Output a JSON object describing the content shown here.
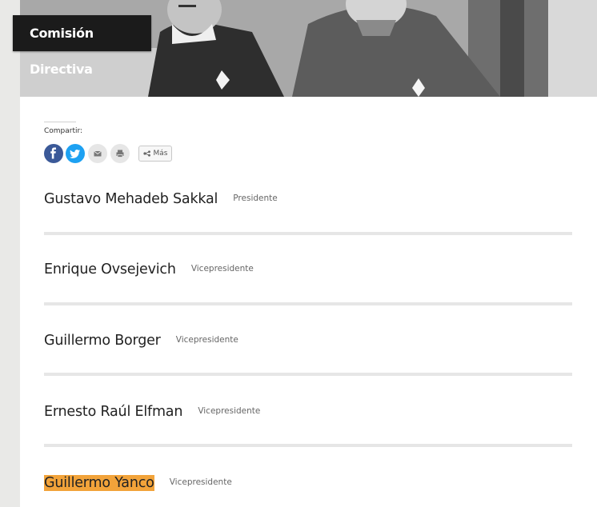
{
  "page": {
    "title": "Comisión Directiva"
  },
  "share": {
    "label": "Compartir:",
    "buttons": [
      {
        "icon": "facebook-icon",
        "color": "#3b5998"
      },
      {
        "icon": "twitter-icon",
        "color": "#1da1f2"
      },
      {
        "icon": "email-icon",
        "color": "#e6e6e6"
      },
      {
        "icon": "print-icon",
        "color": "#e6e6e6"
      }
    ],
    "more_label": "Más"
  },
  "members": [
    {
      "name": "Gustavo Mehadeb Sakkal",
      "role": "Presidente",
      "highlighted": false
    },
    {
      "name": "Enrique Ovsejevich",
      "role": "Vicepresidente",
      "highlighted": false
    },
    {
      "name": "Guillermo Borger",
      "role": "Vicepresidente",
      "highlighted": false
    },
    {
      "name": "Ernesto Raúl Elfman",
      "role": "Vicepresidente",
      "highlighted": false
    },
    {
      "name": "Guillermo Yanco",
      "role": "Vicepresidente",
      "highlighted": true
    }
  ],
  "colors": {
    "highlight": "#f2a33a",
    "badge": "#1b1b1b"
  }
}
